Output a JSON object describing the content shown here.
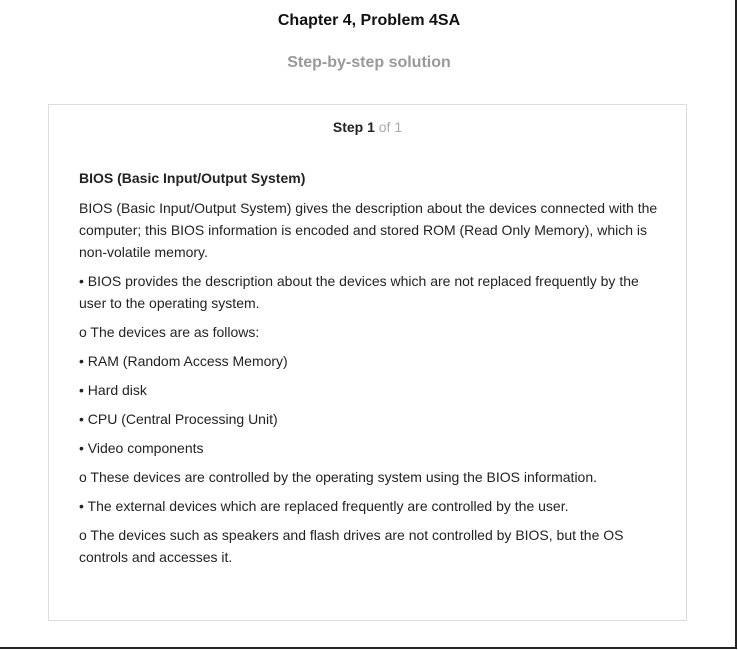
{
  "header": {
    "title": "Chapter 4, Problem 4SA",
    "subtitle": "Step-by-step solution"
  },
  "step": {
    "label": "Step 1",
    "total": "of 1"
  },
  "content": {
    "heading": "BIOS (Basic Input/Output System)",
    "paragraphs": [
      "BIOS (Basic Input/Output System) gives the description about the devices connected with the computer; this BIOS information is encoded and stored ROM (Read Only Memory), which is non-volatile memory.",
      "• BIOS provides the description about the devices which are not replaced frequently by the user to the operating system.",
      "o The devices are as follows:",
      "• RAM (Random Access Memory)",
      "• Hard disk",
      "• CPU (Central Processing Unit)",
      "• Video components",
      "o These devices are controlled by the operating system using the BIOS information.",
      "• The external devices which are replaced frequently are controlled by the user.",
      "o The devices such as speakers and flash drives are not controlled by BIOS, but the OS controls and accesses it."
    ]
  }
}
